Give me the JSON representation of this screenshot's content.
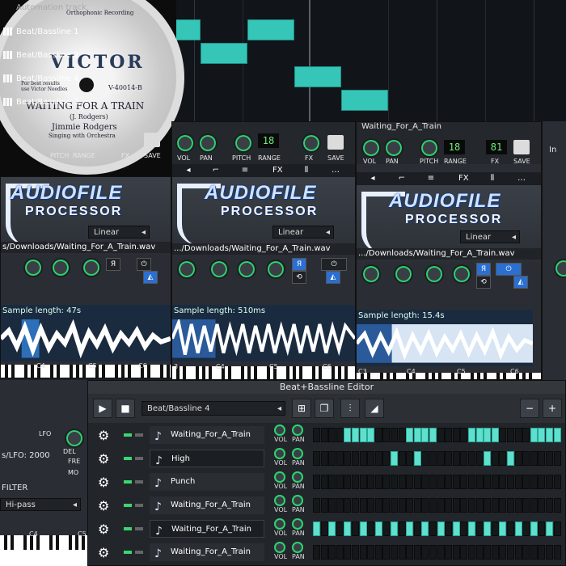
{
  "song_editor": {
    "tracks": [
      {
        "label": "Automation track"
      },
      {
        "label": "Beat/Bassline 1"
      },
      {
        "label": "Beat/Bassline 2"
      },
      {
        "label": "Beat/Bassline 4"
      },
      {
        "label": "Beat/Bassline 3"
      }
    ]
  },
  "record": {
    "brand": "VICTOR",
    "catalog": "V-40014-B",
    "title": "WAITING FOR A TRAIN",
    "composer": "(J. Rodgers)",
    "artist": "Jimmie Rodgers",
    "accompaniment": "Singing with Orchestra",
    "label_top": "Orthophonic Recording",
    "label_small": "For best results use Victor Needles"
  },
  "instruments": [
    {
      "name": "",
      "knobs": [
        "VOL",
        "PAN",
        "PITCH",
        "RANGE",
        "FX",
        "SAVE"
      ],
      "logo_line1": "AUDIOFILE",
      "logo_line2": "PROCESSOR",
      "interp": "Linear",
      "path": "s/Downloads/Waiting_For_A_Train.wav",
      "sample_length": "Sample length: 47s",
      "octaves": [
        "C4",
        "C5",
        "C6"
      ]
    },
    {
      "name": "",
      "knobs": [
        "VOL",
        "PAN",
        "PITCH",
        "RANGE",
        "FX",
        "SAVE"
      ],
      "logo_line1": "AUDIOFILE",
      "logo_line2": "PROCESSOR",
      "interp": "Linear",
      "path": ".../Downloads/Waiting_For_A_Train.wav",
      "sample_length": "Sample length: 510ms",
      "octaves": [
        "3",
        "C4",
        "C5",
        "C6"
      ]
    },
    {
      "name": "Waiting_For_A_Train",
      "knobs": [
        "VOL",
        "PAN",
        "PITCH",
        "RANGE",
        "FX",
        "SAVE"
      ],
      "logo_line1": "AUDIOFILE",
      "logo_line2": "PROCESSOR",
      "interp": "Linear",
      "path": ".../Downloads/Waiting_For_A_Train.wav",
      "sample_length": "Sample length: 15.4s",
      "octaves": [
        "C3",
        "C4",
        "C5",
        "C6"
      ]
    }
  ],
  "side": {
    "in_label": "In"
  },
  "left_instrument": {
    "lfo_label": "LFO",
    "del_label": "DEL",
    "fre_label": "FRE",
    "mo_label": "MO",
    "lfo_value": "s/LFO: 2000",
    "filter_label": "FILTER",
    "filter_type": "Hi-pass",
    "octave": "C4",
    "octave2": "C5"
  },
  "bb_editor": {
    "title": "Beat+Bassline Editor",
    "pattern": "Beat/Bassline 4",
    "tracks": [
      {
        "name": "Waiting_For_A_Train",
        "highlight": false,
        "steps": [
          0,
          0,
          0,
          0,
          1,
          1,
          1,
          1,
          0,
          0,
          0,
          0,
          1,
          1,
          1,
          1,
          0,
          0,
          0,
          0,
          1,
          1,
          1,
          1,
          0,
          0,
          0,
          0,
          1,
          1,
          1,
          1
        ]
      },
      {
        "name": "High",
        "highlight": true,
        "steps": [
          0,
          0,
          0,
          0,
          0,
          0,
          0,
          0,
          0,
          0,
          1,
          0,
          0,
          1,
          0,
          0,
          0,
          0,
          0,
          0,
          0,
          0,
          1,
          0,
          0,
          1,
          0,
          0,
          0,
          0,
          0,
          0
        ]
      },
      {
        "name": "Punch",
        "highlight": false,
        "steps": [
          0,
          0,
          0,
          0,
          0,
          0,
          0,
          0,
          0,
          0,
          0,
          0,
          0,
          0,
          0,
          0,
          0,
          0,
          0,
          0,
          0,
          0,
          0,
          0,
          0,
          0,
          0,
          0,
          0,
          0,
          0,
          0
        ]
      },
      {
        "name": "Waiting_For_A_Train",
        "highlight": false,
        "steps": [
          0,
          0,
          0,
          0,
          0,
          0,
          0,
          0,
          0,
          0,
          0,
          0,
          0,
          0,
          0,
          0,
          0,
          0,
          0,
          0,
          0,
          0,
          0,
          0,
          0,
          0,
          0,
          0,
          0,
          0,
          0,
          0
        ]
      },
      {
        "name": "Waiting_For_A_Train",
        "highlight": true,
        "steps": [
          1,
          0,
          1,
          0,
          1,
          0,
          1,
          0,
          1,
          0,
          1,
          0,
          1,
          0,
          1,
          0,
          1,
          0,
          1,
          0,
          1,
          0,
          1,
          0,
          1,
          0,
          1,
          0,
          1,
          0,
          1,
          0
        ]
      },
      {
        "name": "Waiting_For_A_Train",
        "highlight": false,
        "steps": [
          0,
          0,
          0,
          0,
          0,
          0,
          0,
          0,
          0,
          0,
          0,
          0,
          0,
          0,
          0,
          0,
          0,
          0,
          0,
          0,
          0,
          0,
          0,
          0,
          0,
          0,
          0,
          0,
          0,
          0,
          0,
          0
        ]
      }
    ],
    "vol_label": "VOL",
    "pan_label": "PAN"
  }
}
